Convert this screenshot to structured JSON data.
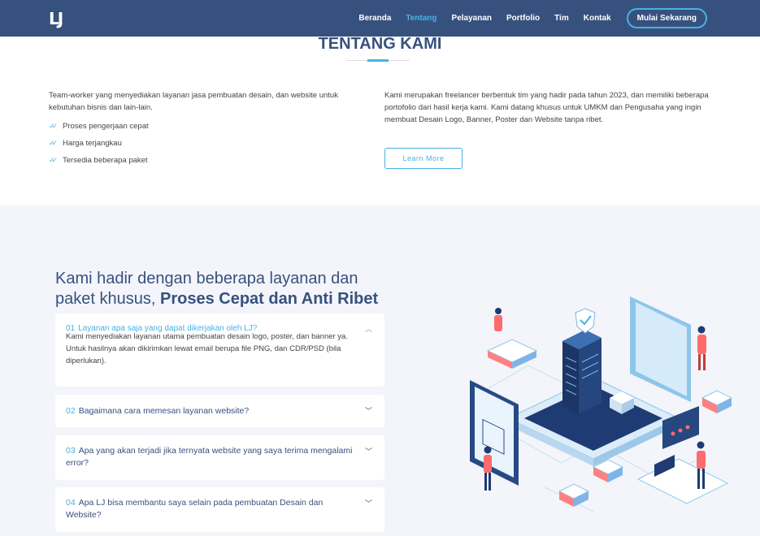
{
  "nav": {
    "logo": "LJ",
    "items": [
      "Beranda",
      "Tentang",
      "Pelayanan",
      "Portfolio",
      "Tim",
      "Kontak"
    ],
    "active": "Tentang",
    "cta": "Mulai Sekarang"
  },
  "about": {
    "title": "TENTANG KAMI",
    "left_text": "Team-worker yang menyediakan layanan jasa pembuatan desain, dan website untuk kebutuhan bisnis dan lain-lain.",
    "features": [
      "Proses pengerjaan cepat",
      "Harga terjangkau",
      "Tersedia beberapa paket"
    ],
    "right_text": "Kami merupakan freelancer berbentuk tim yang hadir pada tahun 2023, dan memiliki beberapa portofolio dari hasil kerja kami. Kami datang khusus untuk UMKM dan Pengusaha yang ingin membuat Desain Logo, Banner, Poster dan Website tanpa ribet.",
    "learn_more": "Learn More"
  },
  "why": {
    "heading_plain": "Kami hadir dengan beberapa layanan dan paket khusus,",
    "heading_bold": "Proses Cepat dan Anti Ribet",
    "faqs": [
      {
        "num": "01",
        "q": "Layanan apa saja yang dapat dikerjakan oleh LJ?",
        "a": "Kami menyediakan layanan utama pembuatan desain logo, poster, dan banner ya. Untuk hasilnya akan dikirimkan lewat email berupa file PNG, dan CDR/PSD (bila diperlukan)."
      },
      {
        "num": "02",
        "q": "Bagaimana cara memesan layanan website?"
      },
      {
        "num": "03",
        "q": "Apa yang akan terjadi jika ternyata website yang saya terima mengalami error?"
      },
      {
        "num": "04",
        "q": "Apa LJ bisa membantu saya selain pada pembuatan Desain dan Website?"
      }
    ]
  },
  "colors": {
    "primary": "#37517e",
    "accent": "#47b2e4",
    "section_bg": "#f3f5fa"
  },
  "icons": {
    "check": "double-check-icon",
    "chevron_up": "chevron-up-icon",
    "chevron_down": "chevron-down-icon"
  }
}
